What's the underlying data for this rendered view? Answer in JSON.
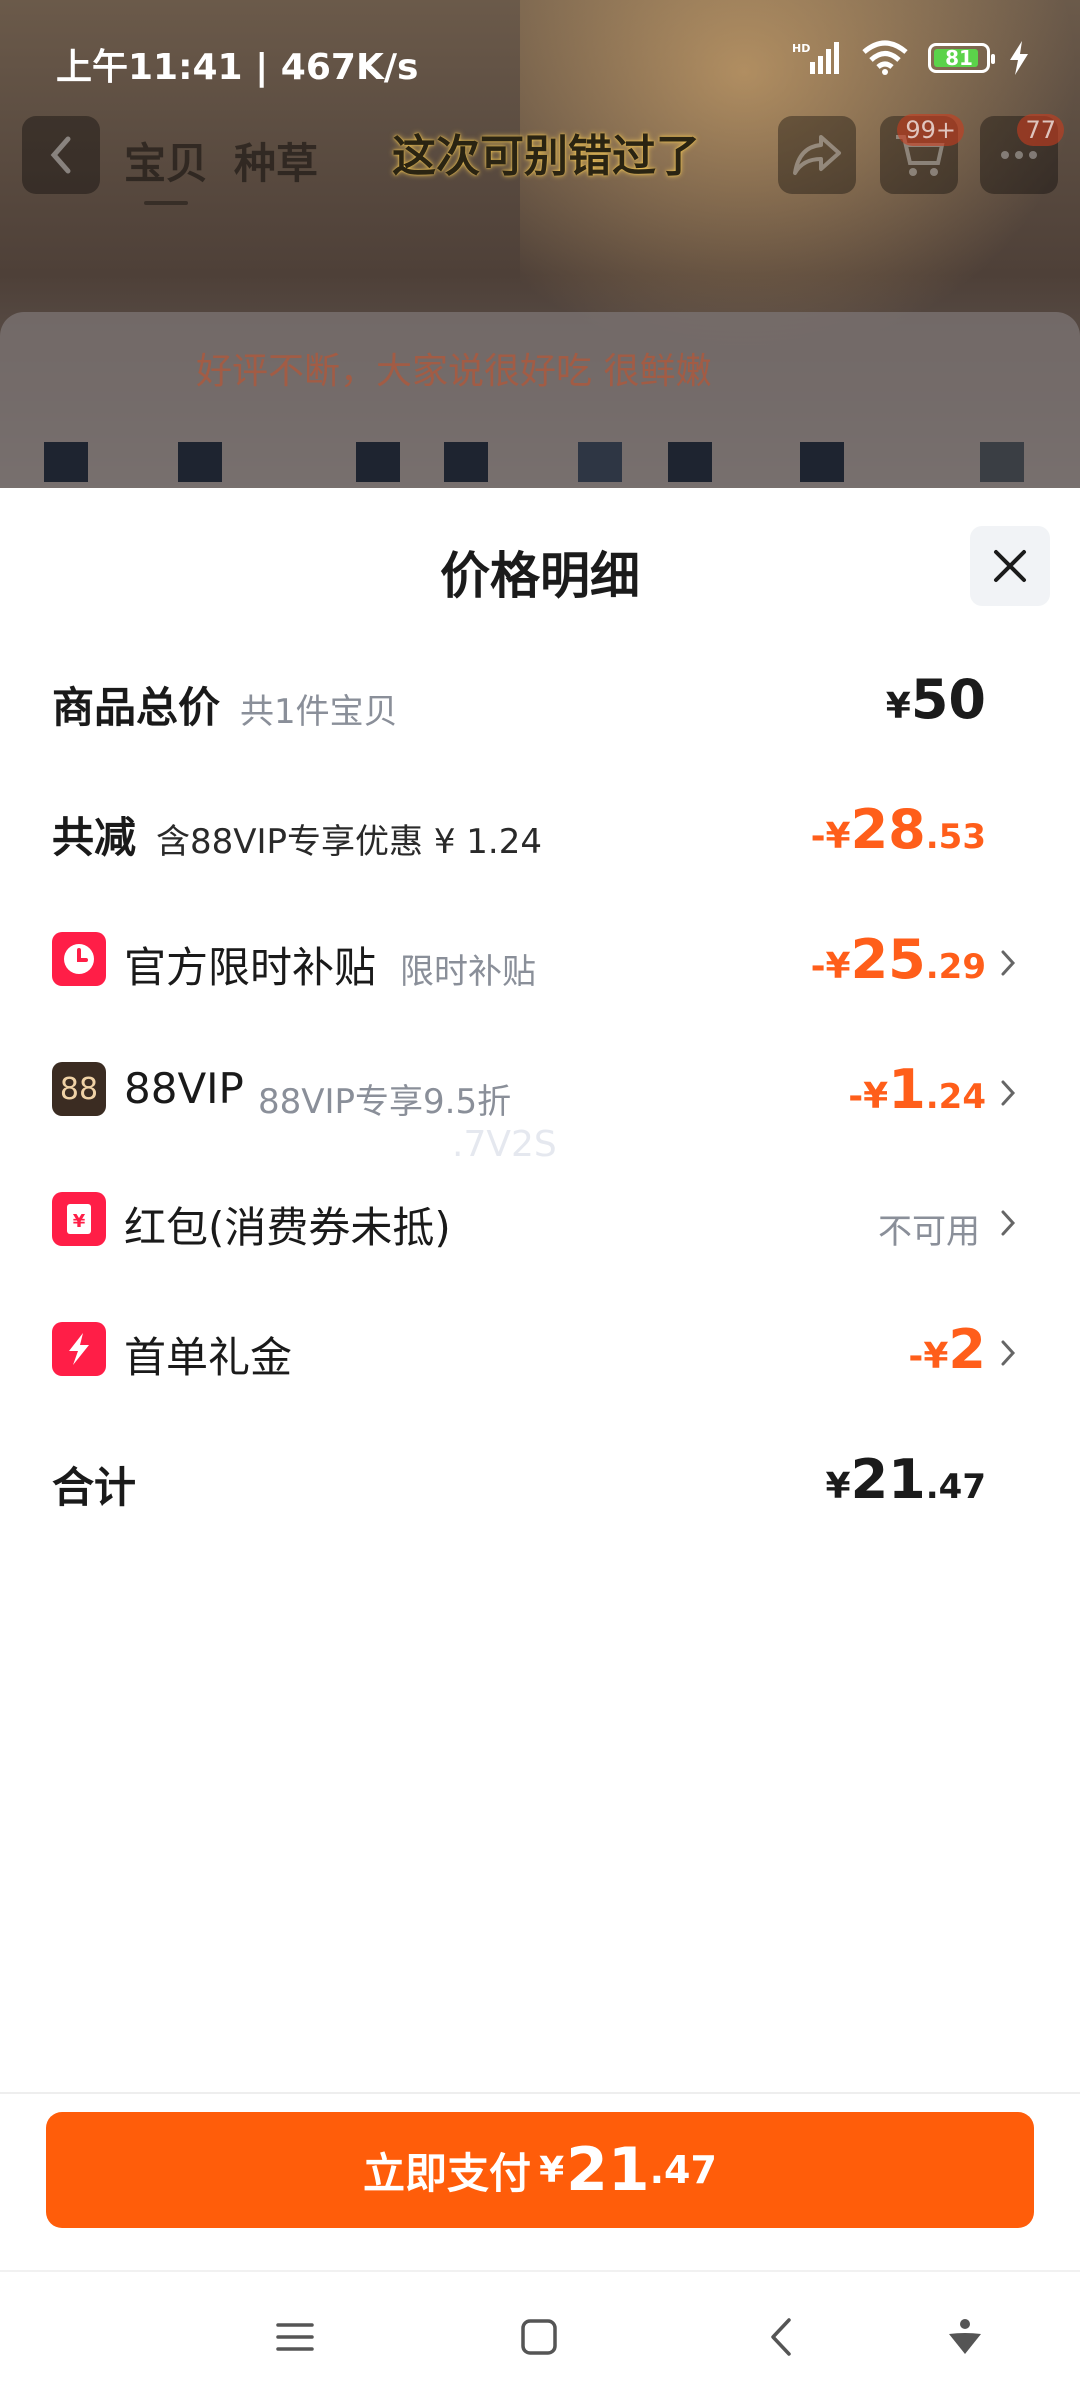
{
  "status_bar": {
    "time_speed": "上午11:41 | 467K/s",
    "battery": "81"
  },
  "nav": {
    "tabs": [
      "宝贝",
      "种草"
    ],
    "banner": "这次可别错过了",
    "cart_badge": "99+",
    "more_badge": "77"
  },
  "background_card": {
    "text": "好评不断，大家说很好吃 很鲜嫩"
  },
  "sheet": {
    "title": "价格明细",
    "rows": {
      "total_price": {
        "label": "商品总价",
        "sub": "共1件宝贝",
        "yen": "¥",
        "int": "50",
        "dec": ""
      },
      "discount": {
        "label": "共减",
        "sub": "含88VIP专享优惠 ¥ 1.24",
        "prefix": "-¥",
        "int": "28",
        "dec": ".53"
      },
      "subsidy": {
        "label": "官方限时补贴",
        "sub": "限时补贴",
        "prefix": "-¥",
        "int": "25",
        "dec": ".29"
      },
      "vip": {
        "label": "88VIP",
        "sub": "88VIP专享9.5折",
        "icon_text": "88",
        "prefix": "-¥",
        "int": "1",
        "dec": ".24"
      },
      "redpacket": {
        "label": "红包(消费券未抵)",
        "status": "不可用"
      },
      "first_order": {
        "label": "首单礼金",
        "prefix": "-¥",
        "int": "2",
        "dec": ""
      },
      "sum": {
        "label": "合计",
        "yen": "¥",
        "int": "21",
        "dec": ".47"
      }
    },
    "watermark": ".7V2S"
  },
  "footer": {
    "pay_label": "立即支付",
    "yen": "¥",
    "int": "21",
    "dec": ".47"
  },
  "colors": {
    "accent": "#ff5d0a",
    "price_orange": "#ff5e1a",
    "icon_red": "#ff1e47",
    "vip_brown": "#3b2c22"
  },
  "icons": {
    "subsidy": "clock-icon",
    "vip": "vip-88-icon",
    "redpacket": "yen-coupon-icon",
    "first_order": "lightning-icon",
    "close": "close-icon",
    "chevron": "chevron-right-icon"
  }
}
